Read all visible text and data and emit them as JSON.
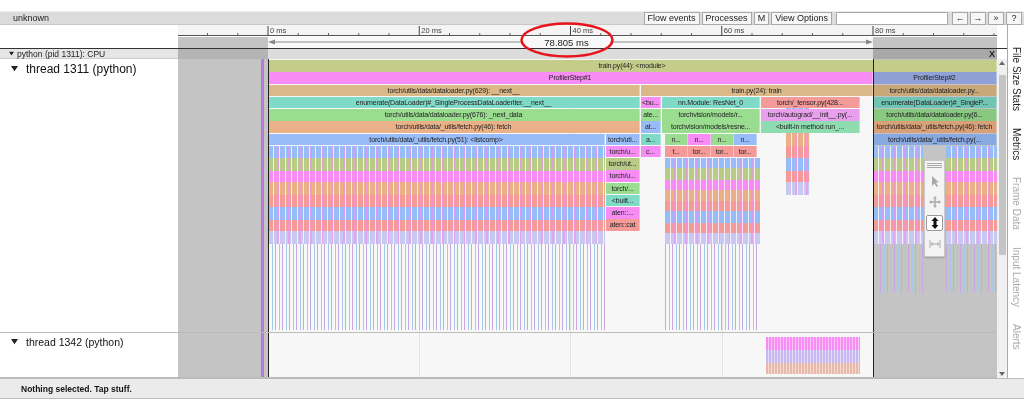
{
  "title": "unknown",
  "toolbar": {
    "buttons": [
      "Flow events",
      "Processes",
      "M",
      "View Options"
    ],
    "nav_buttons": [
      "←",
      "→",
      "»",
      "?"
    ]
  },
  "ruler": {
    "ticks": [
      "0 ms",
      "20 ms",
      "40 ms",
      "60 ms",
      "80 ms"
    ],
    "range": "78.805 ms"
  },
  "process": {
    "label": "python (pid 1311): CPU",
    "expanded": true,
    "close": "X"
  },
  "threads": [
    {
      "name": "thread 1311 (python)",
      "expanded": true,
      "slices": [
        {
          "label": "train.py(44): <module>",
          "color": "#c3cc88",
          "children": [
            {
              "label": "ProfilerStep#1",
              "color": "#f68cf4",
              "children": [
                {
                  "label": "torch/utils/data/dataloader.py(629): __next__",
                  "color": "#dab888",
                  "children": [
                    {
                      "label": "enumerate(DataLoader)#_SingleProcessDataLoaderIter.__next__",
                      "color": "#80dac8",
                      "children": [
                        {
                          "label": "torch/utils/data/dataloader.py(676): _next_data",
                          "color": "#9adc90",
                          "children": [
                            {
                              "label": "torch/utils/data/_utils/fetch.py(46): fetch",
                              "color": "#eab088",
                              "children": [
                                {
                                  "label": "torch/utils/data/_utils/fetch.py(51): <listcomp>",
                                  "color": "#98bcf8"
                                },
                                {
                                  "label": "torch/uti...",
                                  "color": "#98bcf8",
                                  "children": [
                                    {
                                      "label": "torch/u...",
                                      "color": "#f68cf4",
                                      "children": [
                                        {
                                          "label": "torch/ut...",
                                          "color": "#b8cc88",
                                          "children": [
                                            {
                                              "label": "torch/u...",
                                              "color": "#f68cf4",
                                              "children": [
                                                {
                                                  "label": "torch/...",
                                                  "color": "#9adc90",
                                                  "children": [
                                                    {
                                                      "label": "<built...",
                                                      "color": "#80dac8",
                                                      "children": [
                                                        {
                                                          "label": "aten::...",
                                                          "color": "#f68cf4",
                                                          "children": [
                                                            {
                                                              "label": "aten::cat",
                                                              "color": "#f49a98"
                                                            }
                                                          ]
                                                        }
                                                      ]
                                                    }
                                                  ]
                                                }
                                              ]
                                            }
                                          ]
                                        }
                                      ]
                                    }
                                  ]
                                }
                              ]
                            }
                          ]
                        }
                      ]
                    }
                  ]
                },
                {
                  "label": "train.py(24): train",
                  "color": "#dab888",
                  "children": [
                    {
                      "label": "<bu...",
                      "color": "#f68cf4",
                      "children": [
                        {
                          "label": "ate...",
                          "color": "#9adc90",
                          "children": [
                            {
                              "label": "at...",
                              "color": "#98bcf8",
                              "children": [
                                {
                                  "label": "a...",
                                  "color": "#80dac8",
                                  "children": [
                                    {
                                      "label": "c...",
                                      "color": "#f68cf4"
                                    }
                                  ]
                                }
                              ]
                            }
                          ]
                        }
                      ]
                    },
                    {
                      "label": "nn.Module: ResNet_0",
                      "color": "#80dac8",
                      "children": [
                        {
                          "label": "torchvision/models/r...",
                          "color": "#9adc90",
                          "children": [
                            {
                              "label": "torchvision/models/resne...",
                              "color": "#9adc90",
                              "children": [
                                {
                                  "label": "n...",
                                  "color": "#9adc90",
                                  "children": [
                                    {
                                      "label": "t...",
                                      "color": "#f49a98"
                                    }
                                  ]
                                },
                                {
                                  "label": "n...",
                                  "color": "#f68cf4",
                                  "children": [
                                    {
                                      "label": "tor...",
                                      "color": "#f49a98"
                                    }
                                  ]
                                },
                                {
                                  "label": "n...",
                                  "color": "#9adc90",
                                  "children": [
                                    {
                                      "label": "tor...",
                                      "color": "#f49a98"
                                    }
                                  ]
                                },
                                {
                                  "label": "n...",
                                  "color": "#98bcf8",
                                  "children": [
                                    {
                                      "label": "tor...",
                                      "color": "#f49a98"
                                    }
                                  ]
                                }
                              ]
                            }
                          ]
                        }
                      ]
                    },
                    {
                      "label": "torch/_tensor.py(428...",
                      "color": "#f49a98",
                      "children": [
                        {
                          "label": "torch/autograd/__init__.py(...",
                          "color": "#e8a0ec",
                          "children": [
                            {
                              "label": "<built-in method run_...",
                              "color": "#8edcb0"
                            }
                          ]
                        }
                      ]
                    }
                  ]
                }
              ]
            },
            {
              "label": "ProfilerStep#2",
              "color": "#8fa0d6",
              "children": [
                {
                  "label": "torch/utils/data/dataloader.py...",
                  "color": "#c8a878",
                  "children": [
                    {
                      "label": "enumerate(DataLoader)#_SingleP...",
                      "color": "#70c4b4",
                      "children": [
                        {
                          "label": "torch/utils/data/dataloader.py(6...",
                          "color": "#88c880",
                          "children": [
                            {
                              "label": "torch/utils/data/_utils/fetch.py(46): fetch",
                              "color": "#d8a078",
                              "children": [
                                {
                                  "label": "torch/utils/data/_utils/fetch.py(...",
                                  "color": "#88a8e0"
                                }
                              ]
                            }
                          ]
                        }
                      ]
                    }
                  ]
                }
              ]
            }
          ]
        }
      ]
    },
    {
      "name": "thread 1342 (python)",
      "expanded": true
    }
  ],
  "mouse_modes": [
    {
      "kind": "select",
      "selected": false
    },
    {
      "kind": "pan",
      "selected": false
    },
    {
      "kind": "zoom",
      "selected": true
    },
    {
      "kind": "timing",
      "selected": false
    }
  ],
  "side_tabs": [
    {
      "label": "File Size Stats",
      "disabled": false
    },
    {
      "label": "Metrics",
      "disabled": false
    },
    {
      "label": "Frame Data",
      "disabled": true
    },
    {
      "label": "Input Latency",
      "disabled": true
    },
    {
      "label": "Alerts",
      "disabled": true
    }
  ],
  "status": "Nothing selected. Tap stuff."
}
